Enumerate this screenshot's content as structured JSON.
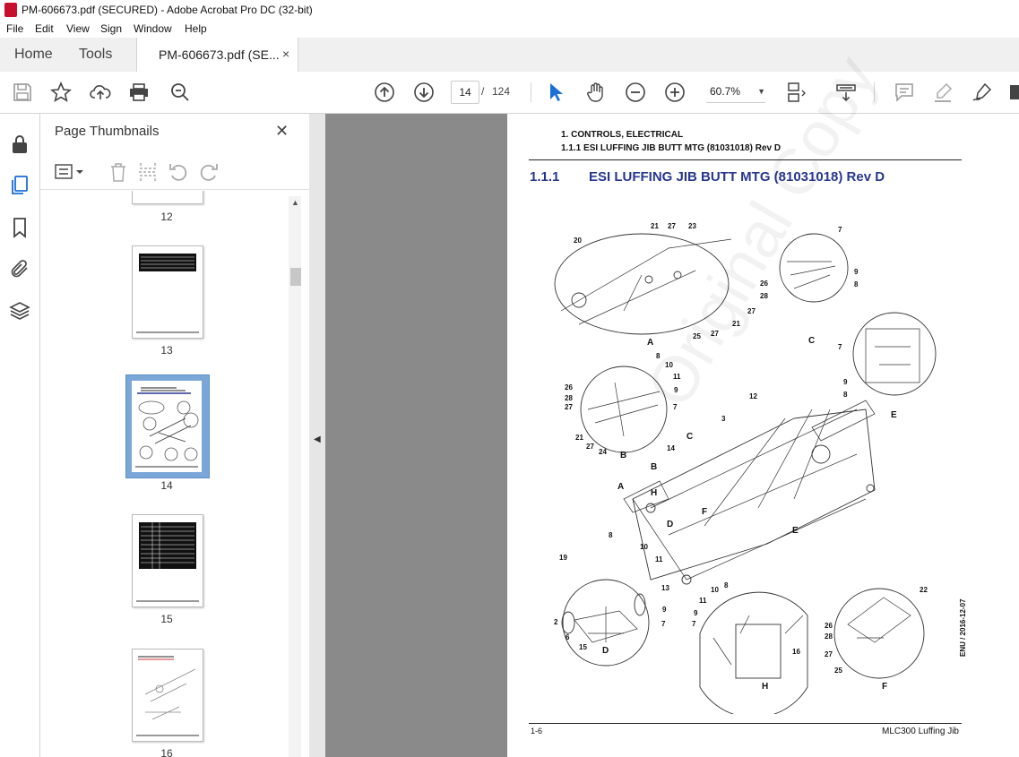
{
  "window": {
    "title": "PM-606673.pdf (SECURED) - Adobe Acrobat Pro DC (32-bit)"
  },
  "menu": [
    "File",
    "Edit",
    "View",
    "Sign",
    "Window",
    "Help"
  ],
  "tabs": {
    "home": "Home",
    "tools": "Tools",
    "document": "PM-606673.pdf (SE...",
    "close": "×"
  },
  "toolbar": {
    "page_current": "14",
    "page_separator": "/",
    "page_total": "124",
    "zoom": "60.7%",
    "zoom_caret": "▼"
  },
  "left_rail": {
    "icons": [
      "lock-icon",
      "page-thumbnails-icon",
      "bookmark-icon",
      "attachment-icon",
      "layers-icon"
    ]
  },
  "thumbnails_panel": {
    "title": "Page Thumbnails",
    "close": "✕",
    "pages": [
      {
        "label": "12"
      },
      {
        "label": "13"
      },
      {
        "label": "14",
        "selected": true
      },
      {
        "label": "15"
      },
      {
        "label": "16"
      }
    ]
  },
  "document_page": {
    "header_line1": "1. CONTROLS, ELECTRICAL",
    "header_line2": "1.1.1 ESI LUFFING JIB BUTT MTG (81031018) Rev D",
    "heading_number": "1.1.1",
    "heading_text": "ESI LUFFING JIB BUTT MTG (81031018) Rev D",
    "footer_left": "1-6",
    "footer_right": "MLC300 Luffing Jib",
    "side_date": "ENU / 2016-12-07",
    "watermark": "Original Copy",
    "view_labels": [
      "A",
      "B",
      "C",
      "D",
      "E",
      "F",
      "H"
    ],
    "callouts": [
      "2",
      "3",
      "6",
      "7",
      "8",
      "9",
      "10",
      "11",
      "12",
      "13",
      "14",
      "15",
      "16",
      "19",
      "20",
      "21",
      "22",
      "23",
      "24",
      "25",
      "26",
      "27",
      "28"
    ]
  },
  "colors": {
    "heading_blue": "#27378f",
    "viewer_gray": "#8a8a8a",
    "select_blue": "#7aa7d8"
  }
}
